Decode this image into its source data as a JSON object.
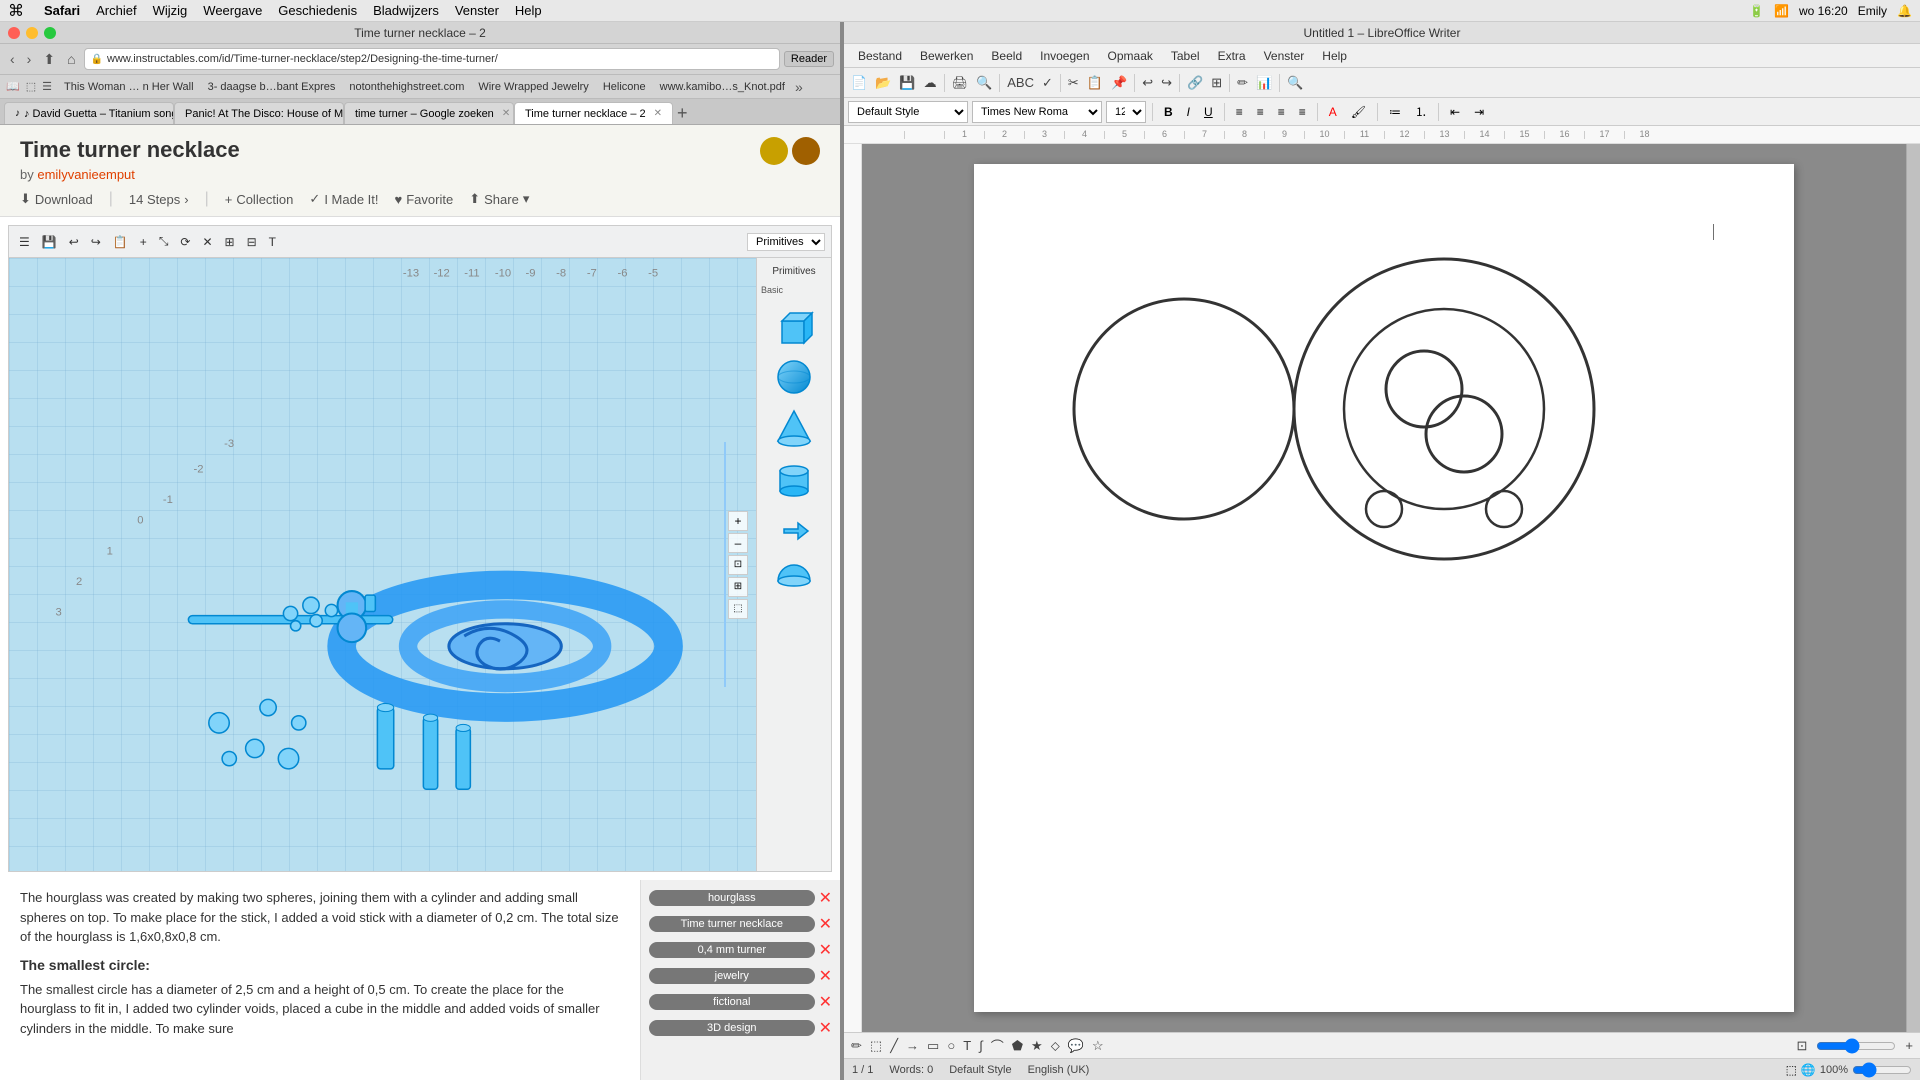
{
  "menubar": {
    "apple": "⌘",
    "items": [
      "Safari",
      "Archief",
      "Wijzig",
      "Weergave",
      "Geschiedenis",
      "Bladwijzers",
      "Venster",
      "Help"
    ],
    "right": {
      "time": "wo 16:20",
      "user": "Emily"
    }
  },
  "safari": {
    "title": "Time turner necklace – 2",
    "traffic_lights": [
      "close",
      "minimize",
      "maximize"
    ],
    "nav": {
      "back": "‹",
      "forward": "›",
      "refresh": "↻",
      "home": "⌂",
      "share": "⬆"
    },
    "address": "www.instructables.com/id/Time-turner-necklace/step2/Designing-the-time-turner/",
    "reader_label": "Reader",
    "bookmarks": [
      "This Woman … n Her Wall",
      "3- daagse b…bant Expres",
      "notonthehighstreet.com",
      "Wire Wrapped Jewelry",
      "Helicone",
      "www.kamibo…s_Knot.pdf"
    ],
    "tabs": [
      {
        "label": "♪ David Guetta – Titanium songte…",
        "active": false
      },
      {
        "label": "Panic! At The Disco: House of Mem…",
        "active": false
      },
      {
        "label": "time turner – Google zoeken",
        "active": false
      },
      {
        "label": "Time turner necklace – 2",
        "active": true
      }
    ],
    "page": {
      "title": "Time turner necklace",
      "author_prefix": "by",
      "author": "emilyvanieemput",
      "actions": {
        "download": "Download",
        "steps": "14 Steps",
        "collection": "Collection",
        "i_made_it": "I Made It!",
        "favorite": "Favorite",
        "share": "Share"
      }
    },
    "tinkercad": {
      "menu_dropdown": "Primitives",
      "basic_label": "Basic",
      "zoom_controls": [
        "+",
        "-",
        "⟳",
        "⬚"
      ]
    },
    "text_content": {
      "paragraph1": "The hourglass was created by making two spheres, joining them with a cylinder and adding small spheres on top. To make place for the stick, I added a void stick with a diameter of 0,2 cm. The total size of the hourglass is 1,6x0,8x0,8 cm.",
      "heading2": "The smallest circle:",
      "paragraph2": "The smallest circle has a diameter of 2,5 cm and a height of 0,5 cm. To create the place for the hourglass to fit in, I added two cylinder voids, placed a cube in the middle and added voids of smaller cylinders in the middle. To make sure"
    },
    "tags": [
      "hourglass",
      "Time turner necklace",
      "0,4 mm turner",
      "jewelry",
      "fictional",
      "3D design"
    ]
  },
  "libreoffice": {
    "title": "Untitled 1 – LibreOffice Writer",
    "menus": [
      "Bestand",
      "Bewerken",
      "Beeld",
      "Invoegen",
      "Opmaak",
      "Tabel",
      "Extra",
      "Venster",
      "Help"
    ],
    "formatting": {
      "style": "Default Style",
      "font": "Times New Roma",
      "size": "12"
    },
    "ruler_marks": [
      "1",
      "2",
      "3",
      "4",
      "5",
      "6",
      "7",
      "8",
      "9",
      "10",
      "11",
      "12",
      "13",
      "14",
      "15",
      "16",
      "17",
      "18"
    ],
    "statusbar": {
      "page": "1 / 1",
      "words": "Words: 0",
      "style": "Default Style",
      "language": "English (UK)"
    }
  }
}
